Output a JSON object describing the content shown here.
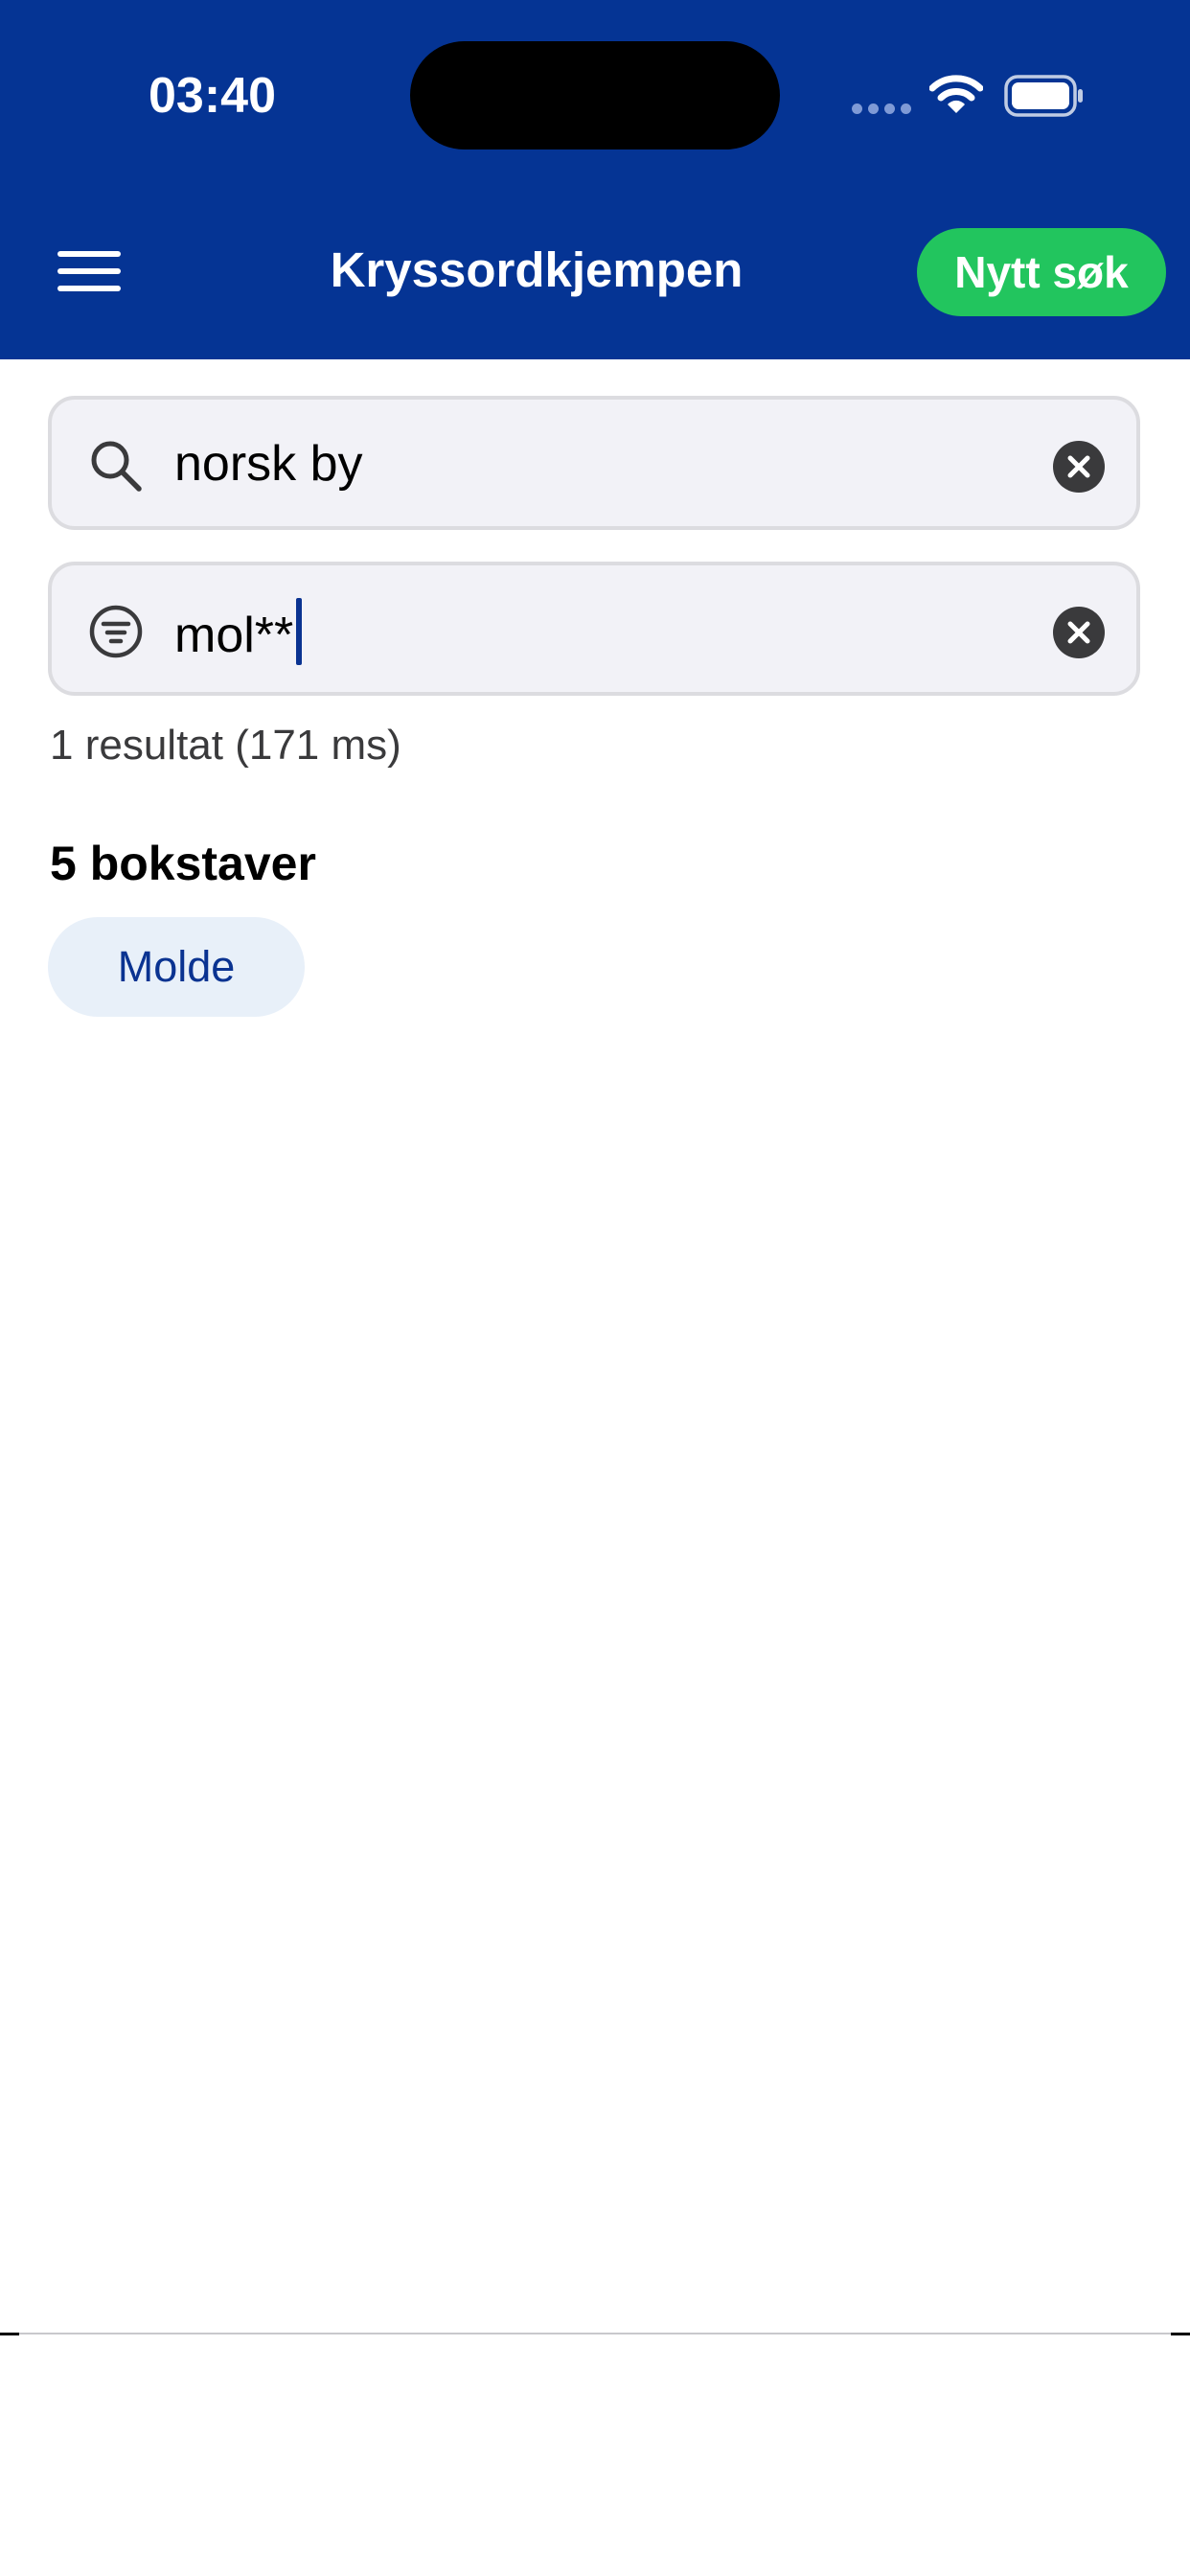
{
  "colors": {
    "header_bg": "#053494",
    "accent_green": "#22c55e",
    "field_bg": "#f2f2f7",
    "chip_bg": "#e8f0f9",
    "chip_text": "#0a3391",
    "caret": "#0a3391",
    "icon_dark": "#3a3a3c"
  },
  "status_bar": {
    "time": "03:40",
    "icons": [
      "signal-dots-icon",
      "wifi-icon",
      "battery-icon"
    ]
  },
  "header": {
    "menu_icon": "hamburger-menu-icon",
    "title": "Kryssordkjempen",
    "new_search_label": "Nytt søk"
  },
  "search": {
    "icon": "search-icon",
    "value": "norsk by",
    "clear_icon": "clear-circle-icon"
  },
  "filter": {
    "icon": "filter-icon",
    "value": "mol**",
    "clear_icon": "clear-circle-icon"
  },
  "results": {
    "summary": "1 resultat (171 ms)",
    "groups": [
      {
        "heading": "5 bokstaver",
        "words": [
          "Molde"
        ]
      }
    ]
  }
}
